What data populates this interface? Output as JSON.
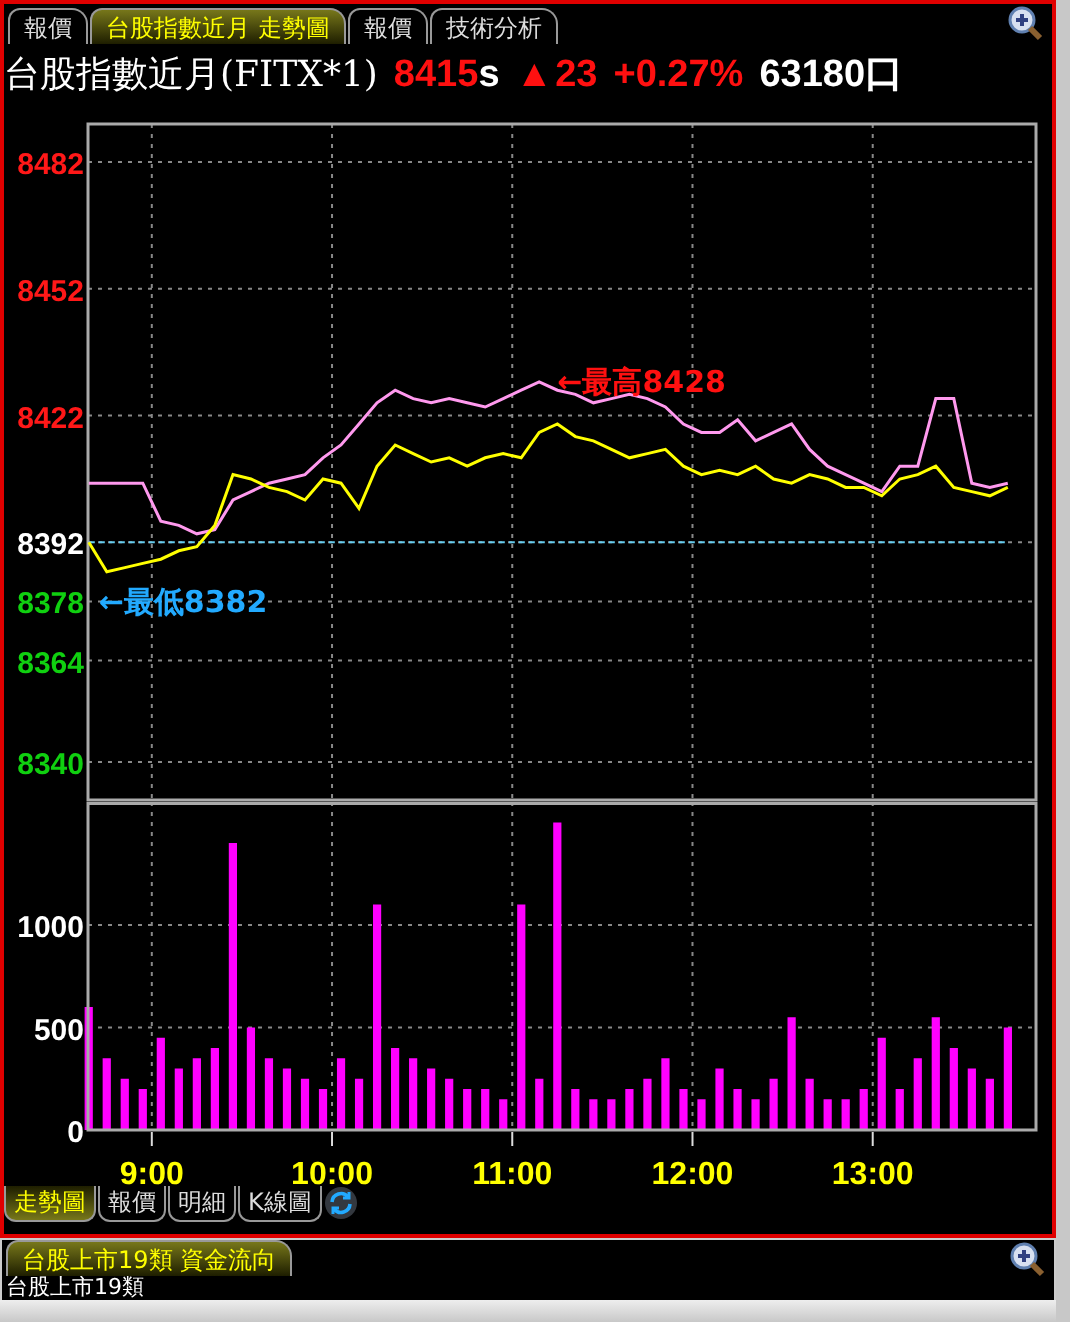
{
  "top_tabs": [
    {
      "label": "報價",
      "selected": false
    },
    {
      "label": "台股指數近月 走勢圖",
      "selected": true
    },
    {
      "label": "報價",
      "selected": false
    },
    {
      "label": "技術分析",
      "selected": false
    }
  ],
  "quote": {
    "name": "台股指數近月(FITX*1)",
    "price": "8415",
    "price_flag": "s",
    "arrow": "▲",
    "change": "23",
    "percent": "+0.27%",
    "volume": "63180口"
  },
  "price_chart": {
    "chart_data": {
      "type": "line",
      "xlim": [
        8.646,
        13.906
      ],
      "ylim": [
        8331,
        8491
      ],
      "yticks": [
        8482,
        8452,
        8422,
        8392,
        8378,
        8364,
        8340
      ],
      "x": [
        8.65,
        8.75,
        8.85,
        8.95,
        9.05,
        9.15,
        9.25,
        9.35,
        9.45,
        9.55,
        9.65,
        9.75,
        9.85,
        9.95,
        10.05,
        10.15,
        10.25,
        10.35,
        10.45,
        10.55,
        10.65,
        10.75,
        10.85,
        10.95,
        11.05,
        11.15,
        11.25,
        11.35,
        11.45,
        11.55,
        11.65,
        11.75,
        11.85,
        11.95,
        12.05,
        12.15,
        12.25,
        12.35,
        12.45,
        12.55,
        12.65,
        12.75,
        12.85,
        12.95,
        13.05,
        13.15,
        13.25,
        13.35,
        13.45,
        13.55,
        13.65,
        13.75
      ],
      "series": [
        {
          "color": "#66ccee",
          "line_style": "dashed",
          "values": [
            8392,
            8392,
            8392,
            8392,
            8392,
            8392,
            8392,
            8392,
            8392,
            8392,
            8392,
            8392,
            8392,
            8392,
            8392,
            8392,
            8392,
            8392,
            8392,
            8392,
            8392,
            8392,
            8392,
            8392,
            8392,
            8392,
            8392,
            8392,
            8392,
            8392,
            8392,
            8392,
            8392,
            8392,
            8392,
            8392,
            8392,
            8392,
            8392,
            8392,
            8392,
            8392,
            8392,
            8392,
            8392,
            8392,
            8392,
            8392,
            8392,
            8392,
            8392,
            8392
          ]
        },
        {
          "color": "#ff99ee",
          "values": [
            8406,
            8406,
            8406,
            8406,
            8397,
            8396,
            8394,
            8395,
            8402,
            8404,
            8406,
            8407,
            8408,
            8412,
            8415,
            8420,
            8425,
            8428,
            8426,
            8425,
            8426,
            8425,
            8424,
            8426,
            8428,
            8430,
            8428,
            8427,
            8425,
            8426,
            8427,
            8426,
            8424,
            8420,
            8418,
            8418,
            8421,
            8416,
            8418,
            8420,
            8414,
            8410,
            8408,
            8406,
            8404,
            8410,
            8410,
            8426,
            8426,
            8406,
            8405,
            8406
          ]
        },
        {
          "color": "#ffff00",
          "values": [
            8392,
            8385,
            8386,
            8387,
            8388,
            8390,
            8391,
            8396,
            8408,
            8407,
            8405,
            8404,
            8402,
            8407,
            8406,
            8400,
            8410,
            8415,
            8413,
            8411,
            8412,
            8410,
            8412,
            8413,
            8412,
            8418,
            8420,
            8417,
            8416,
            8414,
            8412,
            8413,
            8414,
            8410,
            8408,
            8409,
            8408,
            8410,
            8407,
            8406,
            8408,
            8407,
            8405,
            8405,
            8403,
            8407,
            8408,
            8410,
            8405,
            8404,
            8403,
            8405
          ]
        }
      ],
      "grid": true
    },
    "high_label": "←最高8428",
    "low_label": "←最低8382"
  },
  "volume_chart": {
    "chart_data": {
      "type": "bar",
      "grid": true,
      "xlim": [
        8.646,
        13.906
      ],
      "ylim": [
        0,
        1600
      ],
      "yticks": [
        0,
        500,
        1000
      ],
      "xticks": [
        {
          "value": 9,
          "label": "9:00"
        },
        {
          "value": 10,
          "label": "10:00"
        },
        {
          "value": 11,
          "label": "11:00"
        },
        {
          "value": 12,
          "label": "12:00"
        },
        {
          "value": 13,
          "label": "13:00"
        }
      ],
      "x": [
        8.65,
        8.75,
        8.85,
        8.95,
        9.05,
        9.15,
        9.25,
        9.35,
        9.45,
        9.55,
        9.65,
        9.75,
        9.85,
        9.95,
        10.05,
        10.15,
        10.25,
        10.35,
        10.45,
        10.55,
        10.65,
        10.75,
        10.85,
        10.95,
        11.05,
        11.15,
        11.25,
        11.35,
        11.45,
        11.55,
        11.65,
        11.75,
        11.85,
        11.95,
        12.05,
        12.15,
        12.25,
        12.35,
        12.45,
        12.55,
        12.65,
        12.75,
        12.85,
        12.95,
        13.05,
        13.15,
        13.25,
        13.35,
        13.45,
        13.55,
        13.65,
        13.75
      ],
      "series": [
        {
          "color": "#ff00ff",
          "values": [
            600,
            350,
            250,
            200,
            450,
            300,
            350,
            400,
            1400,
            500,
            350,
            300,
            250,
            200,
            350,
            250,
            1100,
            400,
            350,
            300,
            250,
            200,
            200,
            150,
            1100,
            250,
            1500,
            200,
            150,
            150,
            200,
            250,
            350,
            200,
            150,
            300,
            200,
            150,
            250,
            550,
            250,
            150,
            150,
            200,
            450,
            200,
            350,
            550,
            400,
            300,
            250,
            500
          ]
        }
      ]
    }
  },
  "bottom_tabs": [
    {
      "label": "走勢圖",
      "selected": true
    },
    {
      "label": "報價",
      "selected": false
    },
    {
      "label": "明細",
      "selected": false
    },
    {
      "label": "K線圖",
      "selected": false
    }
  ],
  "lower_panel": {
    "tabs": [
      {
        "label": "台股上市19類 資金流向",
        "selected": true
      }
    ],
    "line": "台股上市19類"
  }
}
